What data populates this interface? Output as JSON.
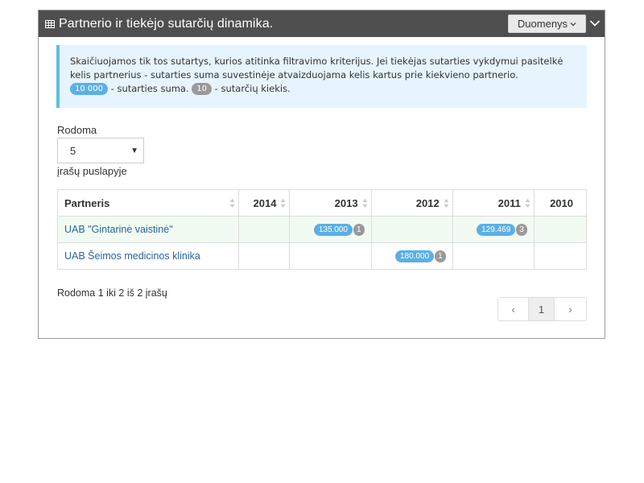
{
  "panel": {
    "title": "Partnerio ir tiekėjo sutarčių dinamika.",
    "dropdown_label": "Duomenys"
  },
  "info": {
    "line1": "Skaičiuojamos tik tos sutartys, kurios atitinka filtravimo kriterijus. Jei tiekėjas sutarties vykdymui pasitelkė kelis partnerius - sutarties suma suvestinėje atvaizduojama kelis kartus prie kiekvieno partnerio.",
    "sum_badge": "10 000",
    "sum_text": " - sutarties suma.",
    "count_badge": "10",
    "count_text": " - sutarčių kiekis."
  },
  "length": {
    "prefix": "Rodoma",
    "value": "5",
    "suffix": "įrašų puslapyje"
  },
  "table": {
    "headers": [
      "Partneris",
      "2014",
      "2013",
      "2012",
      "2011",
      "2010"
    ],
    "rows": [
      {
        "partner": "UAB \"Gintarinė vaistinė\"",
        "cells": {
          "2013": {
            "sum": "135.000",
            "count": "1"
          },
          "2011": {
            "sum": "129.469",
            "count": "3"
          }
        }
      },
      {
        "partner": "UAB Šeimos medicinos klinika",
        "cells": {
          "2012": {
            "sum": "180.000",
            "count": "1"
          }
        }
      }
    ]
  },
  "footer": {
    "info": "Rodoma 1 iki 2 iš 2 įrašų",
    "prev": "‹",
    "page": "1",
    "next": "›"
  },
  "colors": {
    "header_bg": "#4f4f4f",
    "info_bg": "#e6f4fd",
    "info_border": "#5bc0de",
    "badge_blue": "#5bafe4",
    "badge_gray": "#9a9a9a",
    "link": "#2a6496"
  }
}
